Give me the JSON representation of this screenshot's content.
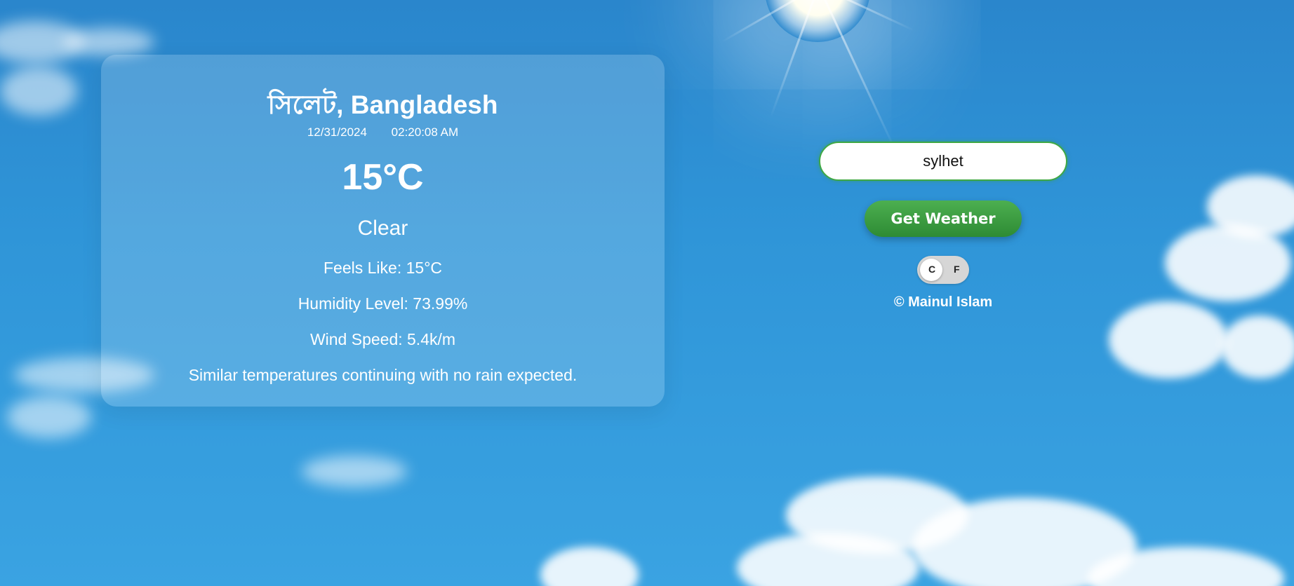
{
  "weather": {
    "city": "সিলেট, Bangladesh",
    "date": "12/31/2024",
    "time": "02:20:08 AM",
    "temperature": "15°C",
    "condition": "Clear",
    "feels_like": "Feels Like: 15°C",
    "humidity": "Humidity Level: 73.99%",
    "wind": "Wind Speed: 5.4k/m",
    "forecast": "Similar temperatures continuing with no rain expected."
  },
  "search": {
    "value": "sylhet",
    "button_label": "Get Weather"
  },
  "unit_toggle": {
    "c_label": "C",
    "f_label": "F",
    "selected": "C"
  },
  "footer": {
    "credit": "© Mainul Islam"
  },
  "colors": {
    "accent": "#3fa845",
    "sky": "#2f95d8"
  }
}
